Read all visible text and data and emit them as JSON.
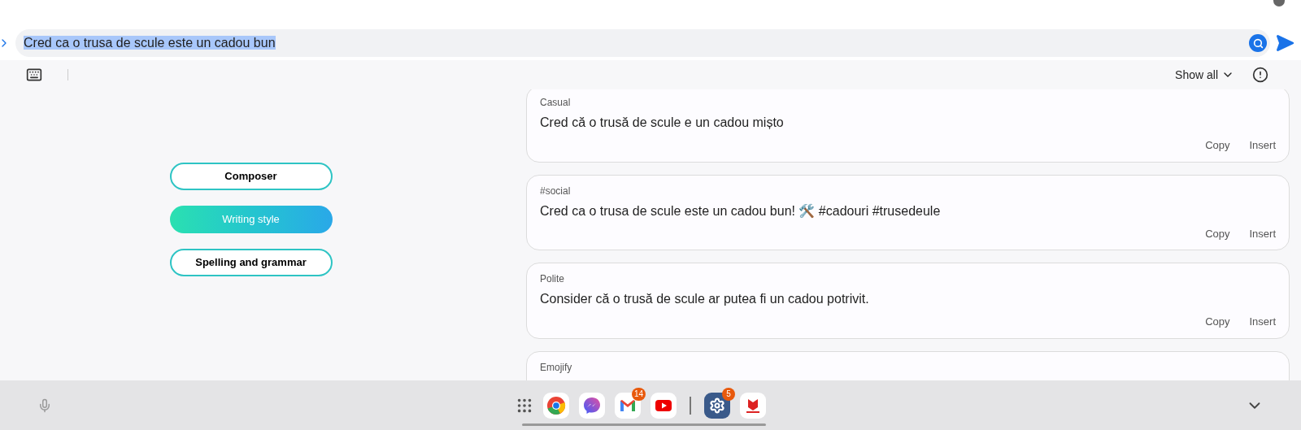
{
  "input": {
    "value": "Cred ca o trusa de scule este un cadou bun",
    "selected": true
  },
  "toolbar": {
    "show_all": "Show all"
  },
  "modes": [
    {
      "label": "Composer",
      "selected": false
    },
    {
      "label": "Writing style",
      "selected": true
    },
    {
      "label": "Spelling and grammar",
      "selected": false
    }
  ],
  "suggestions": [
    {
      "label": "Casual",
      "text": "Cred că o trusă de scule e un cadou mișto",
      "actions": [
        "Copy",
        "Insert"
      ]
    },
    {
      "label": "#social",
      "text": "Cred ca o trusa de scule este un cadou bun! 🛠️ #cadouri #trusedeule",
      "actions": [
        "Copy",
        "Insert"
      ]
    },
    {
      "label": "Polite",
      "text": "Consider că o trusă de scule ar putea fi un cadou potrivit.",
      "actions": [
        "Copy",
        "Insert"
      ]
    },
    {
      "label": "Emojify"
    }
  ],
  "dock": [
    {
      "kind": "grid"
    },
    {
      "kind": "chrome"
    },
    {
      "kind": "messenger"
    },
    {
      "kind": "gmail",
      "badge": "14"
    },
    {
      "kind": "youtube"
    },
    {
      "kind": "divider"
    },
    {
      "kind": "settings",
      "badge": "5"
    },
    {
      "kind": "sameday"
    }
  ]
}
